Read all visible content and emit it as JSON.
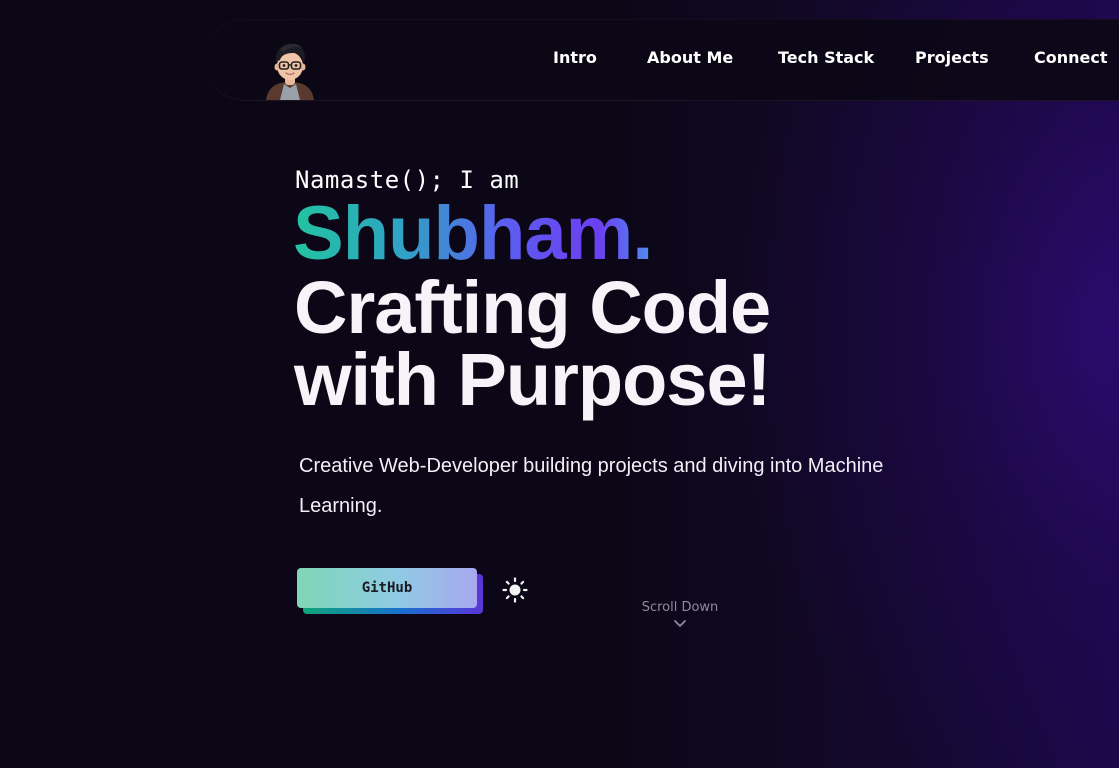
{
  "nav": {
    "avatar_icon": "developer-avatar-icon",
    "items": [
      {
        "label": "Intro"
      },
      {
        "label": "About Me"
      },
      {
        "label": "Tech Stack"
      },
      {
        "label": "Projects"
      },
      {
        "label": "Connect"
      }
    ]
  },
  "hero": {
    "greeting": "Namaste(); I am",
    "name": "Shubham.",
    "tagline_line1": "Crafting Code",
    "tagline_line2": "with Purpose!",
    "subtitle": "Creative Web-Developer building projects and diving into Machine Learning.",
    "github_label": "GitHub",
    "theme_icon": "sun-icon",
    "scroll_label": "Scroll Down",
    "scroll_icon": "chevron-down-icon"
  },
  "colors": {
    "background": "#0b0614",
    "accent_glow": "#2a0c70",
    "name_gradient_start": "#22c3a0",
    "name_gradient_end": "#6b3ff0",
    "button_gradient_start": "#7fd6b6",
    "button_gradient_end": "#a8a8ee"
  }
}
